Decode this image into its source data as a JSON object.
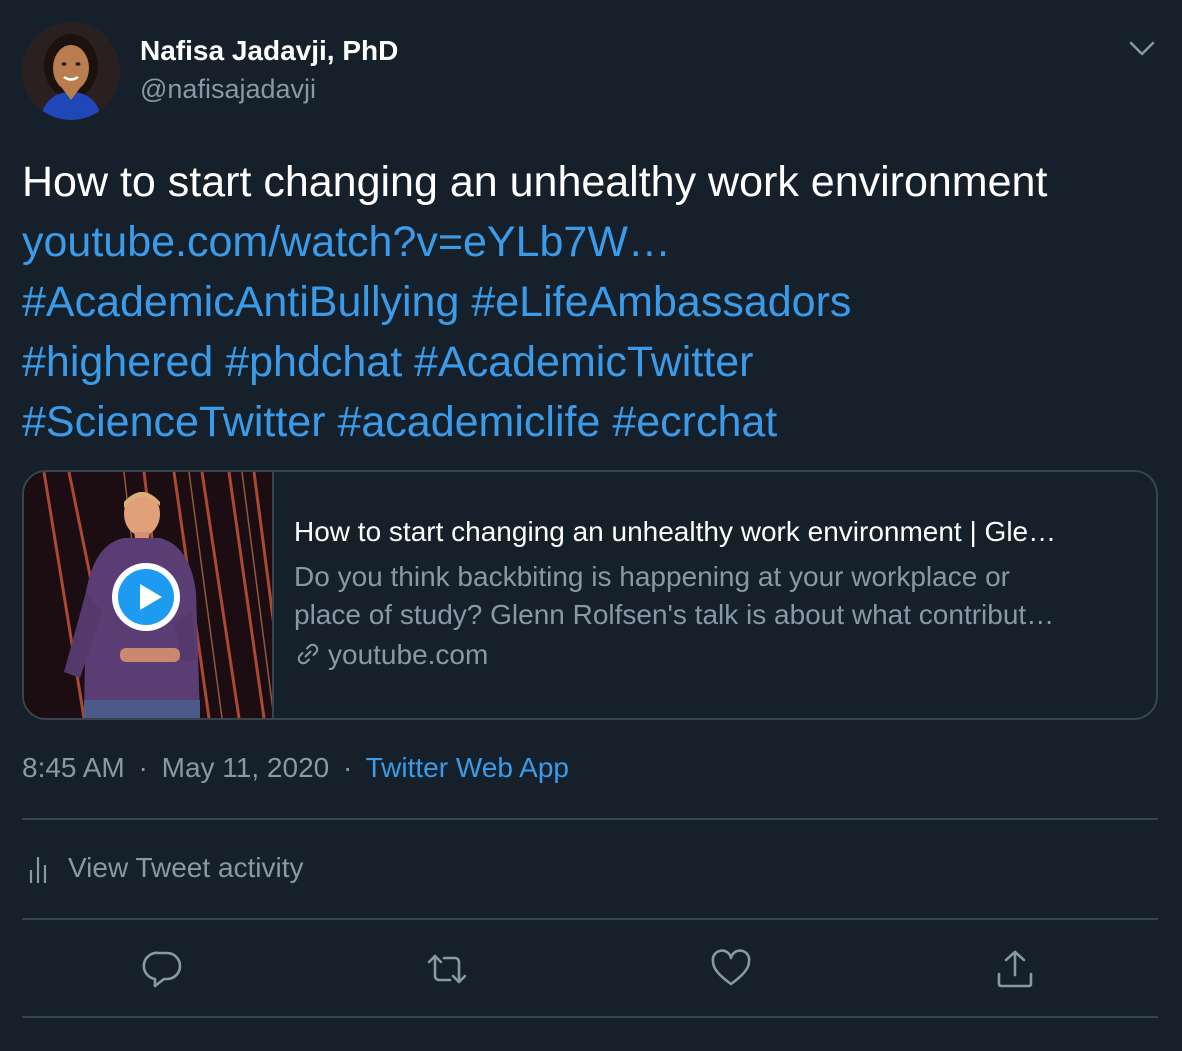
{
  "author": {
    "name": "Nafisa Jadavji, PhD",
    "handle": "@nafisajadavji"
  },
  "tweet": {
    "lines": [
      "How to start changing an unhealthy work environment"
    ],
    "link": "youtube.com/watch?v=eYLb7W…",
    "hashtag_lines": [
      "#AcademicAntiBullying #eLifeAmbassadors",
      "#highered  #phdchat  #AcademicTwitter",
      "#ScienceTwitter  #academiclife #ecrchat"
    ]
  },
  "card": {
    "title": "How to start changing an unhealthy work environment | Gle…",
    "description_lines": [
      "Do you think backbiting is happening at your workplace or",
      "place of study? Glenn Rolfsen's talk is about what contribut…"
    ],
    "domain": "youtube.com"
  },
  "meta": {
    "time": "8:45 AM",
    "date": "May 11, 2020",
    "source": "Twitter Web App",
    "separator": "·"
  },
  "activity_label": "View Tweet activity",
  "icons": {
    "menu": "chevron-down-icon",
    "reply": "reply-icon",
    "retweet": "retweet-icon",
    "like": "heart-icon",
    "share": "share-icon",
    "analytics": "analytics-icon",
    "link": "link-icon",
    "play": "play-icon"
  },
  "colors": {
    "background": "#15202b",
    "link": "#3b9be8",
    "secondary_text": "#8899a6",
    "border": "#38444d"
  }
}
